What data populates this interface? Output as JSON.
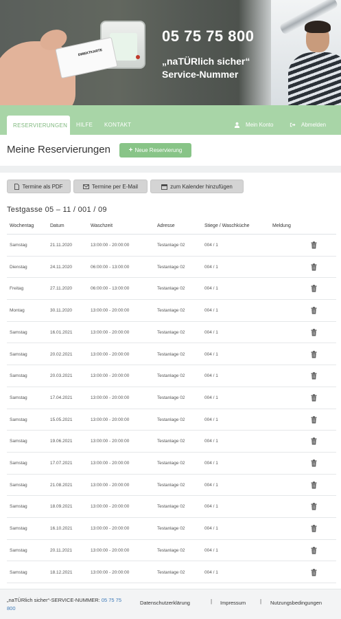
{
  "hero": {
    "phone": "05 75 75 800",
    "tagline_line1": "„naTÜRlich sicher“",
    "tagline_line2": "Service-Nummer",
    "card_label": "DIREKTKARTE"
  },
  "nav": {
    "tabs": [
      {
        "label": "RESERVIERUNGEN",
        "active": true
      },
      {
        "label": "HILFE",
        "active": false
      },
      {
        "label": "KONTAKT",
        "active": false
      }
    ],
    "account_label": "Mein Konto",
    "logout_label": "Abmelden"
  },
  "page": {
    "title": "Meine Reservierungen",
    "new_button": "Neue Reservierung"
  },
  "actions": {
    "pdf": "Termine als PDF",
    "email": "Termine per E-Mail",
    "calendar": "zum Kalender hinzufügen"
  },
  "address": "Testgasse 05 – 11 / 001 / 09",
  "table": {
    "headers": [
      "Wochentag",
      "Datum",
      "Waschzeit",
      "Adresse",
      "Stiege / Waschküche",
      "Meldung"
    ],
    "rows": [
      {
        "day": "Samstag",
        "date": "21.11.2020",
        "time": "13:00:00 - 20:00:00",
        "address": "Testanlage 02",
        "stair": "004 / 1"
      },
      {
        "day": "Dienstag",
        "date": "24.11.2020",
        "time": "06:00:00 - 13:00:00",
        "address": "Testanlage 02",
        "stair": "004 / 1"
      },
      {
        "day": "Freitag",
        "date": "27.11.2020",
        "time": "06:00:00 - 13:00:00",
        "address": "Testanlage 02",
        "stair": "004 / 1"
      },
      {
        "day": "Montag",
        "date": "30.11.2020",
        "time": "13:00:00 - 20:00:00",
        "address": "Testanlage 02",
        "stair": "004 / 1"
      },
      {
        "day": "Samstag",
        "date": "16.01.2021",
        "time": "13:00:00 - 20:00:00",
        "address": "Testanlage 02",
        "stair": "004 / 1"
      },
      {
        "day": "Samstag",
        "date": "20.02.2021",
        "time": "13:00:00 - 20:00:00",
        "address": "Testanlage 02",
        "stair": "004 / 1"
      },
      {
        "day": "Samstag",
        "date": "20.03.2021",
        "time": "13:00:00 - 20:00:00",
        "address": "Testanlage 02",
        "stair": "004 / 1"
      },
      {
        "day": "Samstag",
        "date": "17.04.2021",
        "time": "13:00:00 - 20:00:00",
        "address": "Testanlage 02",
        "stair": "004 / 1"
      },
      {
        "day": "Samstag",
        "date": "15.05.2021",
        "time": "13:00:00 - 20:00:00",
        "address": "Testanlage 02",
        "stair": "004 / 1"
      },
      {
        "day": "Samstag",
        "date": "19.06.2021",
        "time": "13:00:00 - 20:00:00",
        "address": "Testanlage 02",
        "stair": "004 / 1"
      },
      {
        "day": "Samstag",
        "date": "17.07.2021",
        "time": "13:00:00 - 20:00:00",
        "address": "Testanlage 02",
        "stair": "004 / 1"
      },
      {
        "day": "Samstag",
        "date": "21.08.2021",
        "time": "13:00:00 - 20:00:00",
        "address": "Testanlage 02",
        "stair": "004 / 1"
      },
      {
        "day": "Samstag",
        "date": "18.09.2021",
        "time": "13:00:00 - 20:00:00",
        "address": "Testanlage 02",
        "stair": "004 / 1"
      },
      {
        "day": "Samstag",
        "date": "16.10.2021",
        "time": "13:00:00 - 20:00:00",
        "address": "Testanlage 02",
        "stair": "004 / 1"
      },
      {
        "day": "Samstag",
        "date": "20.11.2021",
        "time": "13:00:00 - 20:00:00",
        "address": "Testanlage 02",
        "stair": "004 / 1"
      },
      {
        "day": "Samstag",
        "date": "18.12.2021",
        "time": "13:00:00 - 20:00:00",
        "address": "Testanlage 02",
        "stair": "004 / 1"
      }
    ]
  },
  "footer": {
    "service_label": "„naTÜRlich sicher“-SERVICE-NUMMER:",
    "service_phone": "05 75 75 800",
    "privacy": "Datenschutzerklärung",
    "imprint": "Impressum",
    "terms": "Nutzungsbedingungen",
    "separator": "|"
  },
  "colors": {
    "brand_green": "#a8d5a7",
    "button_green": "#88c487",
    "link_blue": "#3c79b8"
  }
}
